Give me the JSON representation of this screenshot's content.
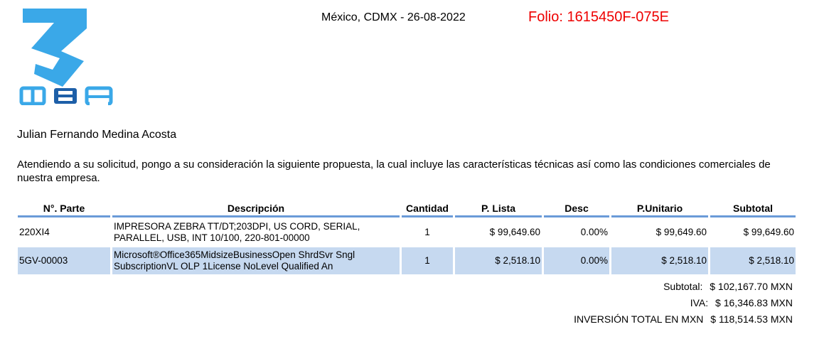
{
  "logo": {
    "text": "MBR",
    "color": "#3aa8e8",
    "accent_color": "#1d5fa8"
  },
  "header": {
    "place_date": "México, CDMX - 26-08-2022",
    "folio": "Folio: 1615450F-075E",
    "folio_color": "#ee0000"
  },
  "recipient": "Julian Fernando Medina Acosta",
  "intro": "Atendiendo a su solicitud, pongo a su consideración la siguiente propuesta, la cual incluye las características técnicas así como las condiciones comerciales de nuestra empresa.",
  "table": {
    "header_rule_color": "#6a9bd8",
    "alt_row_color": "#c6d9f0",
    "columns": [
      "N°. Parte",
      "Descripción",
      "Cantidad",
      "P. Lista",
      "Desc",
      "P.Unitario",
      "Subtotal"
    ],
    "rows": [
      {
        "part": "220XI4",
        "description": "IMPRESORA ZEBRA TT/DT;203DPI, US CORD, SERIAL, PARALLEL, USB, INT 10/100, 220-801-00000",
        "quantity": "1",
        "list_price": "$ 99,649.60",
        "discount": "0.00%",
        "unit_price": "$ 99,649.60",
        "subtotal": "$ 99,649.60"
      },
      {
        "part": "5GV-00003",
        "description": "Microsoft®Office365MidsizeBusinessOpen ShrdSvr Sngl SubscriptionVL OLP 1License NoLevel Qualified An",
        "quantity": "1",
        "list_price": "$ 2,518.10",
        "discount": "0.00%",
        "unit_price": "$ 2,518.10",
        "subtotal": "$ 2,518.10"
      }
    ]
  },
  "totals": {
    "subtotal_label": "Subtotal:",
    "subtotal_value": "$ 102,167.70 MXN",
    "iva_label": "IVA:",
    "iva_value": "$ 16,346.83 MXN",
    "total_label": "INVERSIÓN TOTAL EN MXN",
    "total_value": "$ 118,514.53 MXN"
  }
}
